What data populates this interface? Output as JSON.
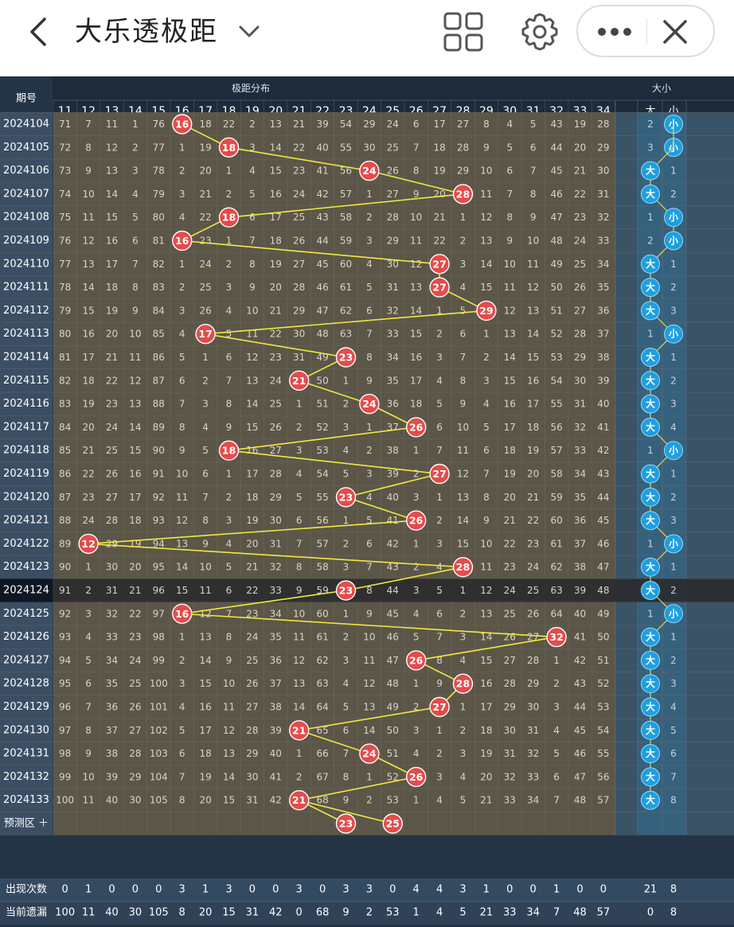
{
  "header": {
    "title": "大乐透极距",
    "icons": [
      "back-icon",
      "chevron-down-icon",
      "grid-icon",
      "gear-icon",
      "more-icon",
      "close-icon"
    ]
  },
  "chart": {
    "col_issue": "期号",
    "group_label": "极距分布",
    "size_label": "大小",
    "big": "大",
    "small": "小",
    "predict_label": "预测区 ＋",
    "stat_labels": [
      "出现次数",
      "当前遗漏"
    ]
  },
  "chart_data": {
    "type": "table",
    "columns": [
      11,
      12,
      13,
      14,
      15,
      16,
      17,
      18,
      19,
      20,
      21,
      22,
      23,
      24,
      25,
      26,
      27,
      28,
      29,
      30,
      31,
      32,
      33,
      34
    ],
    "rows": [
      {
        "issue": "2024104",
        "values": [
          71,
          7,
          11,
          1,
          76,
          16,
          18,
          22,
          2,
          13,
          21,
          39,
          54,
          29,
          24,
          6,
          17,
          27,
          8,
          4,
          5,
          43,
          19,
          28
        ],
        "size": [
          "2",
          "小"
        ]
      },
      {
        "issue": "2024105",
        "values": [
          72,
          8,
          12,
          2,
          77,
          1,
          19,
          18,
          3,
          14,
          22,
          40,
          55,
          30,
          25,
          7,
          18,
          28,
          9,
          5,
          6,
          44,
          20,
          29
        ],
        "size": [
          "3",
          "小"
        ]
      },
      {
        "issue": "2024106",
        "values": [
          73,
          9,
          13,
          3,
          78,
          2,
          20,
          1,
          4,
          15,
          23,
          41,
          56,
          24,
          26,
          8,
          19,
          29,
          10,
          6,
          7,
          45,
          21,
          30
        ],
        "size": [
          "大",
          "1"
        ]
      },
      {
        "issue": "2024107",
        "values": [
          74,
          10,
          14,
          4,
          79,
          3,
          21,
          2,
          5,
          16,
          24,
          42,
          57,
          1,
          27,
          9,
          20,
          28,
          11,
          7,
          8,
          46,
          22,
          31
        ],
        "size": [
          "大",
          "2"
        ]
      },
      {
        "issue": "2024108",
        "values": [
          75,
          11,
          15,
          5,
          80,
          4,
          22,
          18,
          6,
          17,
          25,
          43,
          58,
          2,
          28,
          10,
          21,
          1,
          12,
          8,
          9,
          47,
          23,
          32
        ],
        "size": [
          "1",
          "小"
        ]
      },
      {
        "issue": "2024109",
        "values": [
          76,
          12,
          16,
          6,
          81,
          16,
          23,
          1,
          7,
          18,
          26,
          44,
          59,
          3,
          29,
          11,
          22,
          2,
          13,
          9,
          10,
          48,
          24,
          33
        ],
        "size": [
          "2",
          "小"
        ]
      },
      {
        "issue": "2024110",
        "values": [
          77,
          13,
          17,
          7,
          82,
          1,
          24,
          2,
          8,
          19,
          27,
          45,
          60,
          4,
          30,
          12,
          27,
          3,
          14,
          10,
          11,
          49,
          25,
          34
        ],
        "size": [
          "大",
          "1"
        ]
      },
      {
        "issue": "2024111",
        "values": [
          78,
          14,
          18,
          8,
          83,
          2,
          25,
          3,
          9,
          20,
          28,
          46,
          61,
          5,
          31,
          13,
          27,
          4,
          15,
          11,
          12,
          50,
          26,
          35
        ],
        "size": [
          "大",
          "2"
        ]
      },
      {
        "issue": "2024112",
        "values": [
          79,
          15,
          19,
          9,
          84,
          3,
          26,
          4,
          10,
          21,
          29,
          47,
          62,
          6,
          32,
          14,
          1,
          5,
          29,
          12,
          13,
          51,
          27,
          36
        ],
        "size": [
          "大",
          "3"
        ]
      },
      {
        "issue": "2024113",
        "values": [
          80,
          16,
          20,
          10,
          85,
          4,
          17,
          5,
          11,
          22,
          30,
          48,
          63,
          7,
          33,
          15,
          2,
          6,
          1,
          13,
          14,
          52,
          28,
          37
        ],
        "size": [
          "1",
          "小"
        ]
      },
      {
        "issue": "2024114",
        "values": [
          81,
          17,
          21,
          11,
          86,
          5,
          1,
          6,
          12,
          23,
          31,
          49,
          23,
          8,
          34,
          16,
          3,
          7,
          2,
          14,
          15,
          53,
          29,
          38
        ],
        "size": [
          "大",
          "1"
        ]
      },
      {
        "issue": "2024115",
        "values": [
          82,
          18,
          22,
          12,
          87,
          6,
          2,
          7,
          13,
          24,
          21,
          50,
          1,
          9,
          35,
          17,
          4,
          8,
          3,
          15,
          16,
          54,
          30,
          39
        ],
        "size": [
          "大",
          "2"
        ]
      },
      {
        "issue": "2024116",
        "values": [
          83,
          19,
          23,
          13,
          88,
          7,
          3,
          8,
          14,
          25,
          1,
          51,
          2,
          24,
          36,
          18,
          5,
          9,
          4,
          16,
          17,
          55,
          31,
          40
        ],
        "size": [
          "大",
          "3"
        ]
      },
      {
        "issue": "2024117",
        "values": [
          84,
          20,
          24,
          14,
          89,
          8,
          4,
          9,
          15,
          26,
          2,
          52,
          3,
          1,
          37,
          26,
          6,
          10,
          5,
          17,
          18,
          56,
          32,
          41
        ],
        "size": [
          "大",
          "4"
        ]
      },
      {
        "issue": "2024118",
        "values": [
          85,
          21,
          25,
          15,
          90,
          9,
          5,
          18,
          16,
          27,
          3,
          53,
          4,
          2,
          38,
          1,
          7,
          11,
          6,
          18,
          19,
          57,
          33,
          42
        ],
        "size": [
          "1",
          "小"
        ]
      },
      {
        "issue": "2024119",
        "values": [
          86,
          22,
          26,
          16,
          91,
          10,
          6,
          1,
          17,
          28,
          4,
          54,
          5,
          3,
          39,
          2,
          27,
          12,
          7,
          19,
          20,
          58,
          34,
          43
        ],
        "size": [
          "大",
          "1"
        ]
      },
      {
        "issue": "2024120",
        "values": [
          87,
          23,
          27,
          17,
          92,
          11,
          7,
          2,
          18,
          29,
          5,
          55,
          23,
          4,
          40,
          3,
          1,
          13,
          8,
          20,
          21,
          59,
          35,
          44
        ],
        "size": [
          "大",
          "2"
        ]
      },
      {
        "issue": "2024121",
        "values": [
          88,
          24,
          28,
          18,
          93,
          12,
          8,
          3,
          19,
          30,
          6,
          56,
          1,
          5,
          41,
          26,
          2,
          14,
          9,
          21,
          22,
          60,
          36,
          45
        ],
        "size": [
          "大",
          "3"
        ]
      },
      {
        "issue": "2024122",
        "values": [
          89,
          12,
          29,
          19,
          94,
          13,
          9,
          4,
          20,
          31,
          7,
          57,
          2,
          6,
          42,
          1,
          3,
          15,
          10,
          22,
          23,
          61,
          37,
          46
        ],
        "size": [
          "1",
          "小"
        ]
      },
      {
        "issue": "2024123",
        "values": [
          90,
          1,
          30,
          20,
          95,
          14,
          10,
          5,
          21,
          32,
          8,
          58,
          3,
          7,
          43,
          2,
          4,
          28,
          11,
          23,
          24,
          62,
          38,
          47
        ],
        "size": [
          "大",
          "1"
        ]
      },
      {
        "issue": "2024124",
        "values": [
          91,
          2,
          31,
          21,
          96,
          15,
          11,
          6,
          22,
          33,
          9,
          59,
          23,
          8,
          44,
          3,
          5,
          1,
          12,
          24,
          25,
          63,
          39,
          48
        ],
        "size": [
          "大",
          "2"
        ]
      },
      {
        "issue": "2024125",
        "values": [
          92,
          3,
          32,
          22,
          97,
          16,
          12,
          7,
          23,
          34,
          10,
          60,
          1,
          9,
          45,
          4,
          6,
          2,
          13,
          25,
          26,
          64,
          40,
          49
        ],
        "size": [
          "1",
          "小"
        ]
      },
      {
        "issue": "2024126",
        "values": [
          93,
          4,
          33,
          23,
          98,
          1,
          13,
          8,
          24,
          35,
          11,
          61,
          2,
          10,
          46,
          5,
          7,
          3,
          14,
          26,
          27,
          32,
          41,
          50
        ],
        "size": [
          "大",
          "1"
        ]
      },
      {
        "issue": "2024127",
        "values": [
          94,
          5,
          34,
          24,
          99,
          2,
          14,
          9,
          25,
          36,
          12,
          62,
          3,
          11,
          47,
          26,
          8,
          4,
          15,
          27,
          28,
          1,
          42,
          51
        ],
        "size": [
          "大",
          "2"
        ]
      },
      {
        "issue": "2024128",
        "values": [
          95,
          6,
          35,
          25,
          100,
          3,
          15,
          10,
          26,
          37,
          13,
          63,
          4,
          12,
          48,
          1,
          9,
          28,
          16,
          28,
          29,
          2,
          43,
          52
        ],
        "size": [
          "大",
          "3"
        ]
      },
      {
        "issue": "2024129",
        "values": [
          96,
          7,
          36,
          26,
          101,
          4,
          16,
          11,
          27,
          38,
          14,
          64,
          5,
          13,
          49,
          2,
          27,
          1,
          17,
          29,
          30,
          3,
          44,
          53
        ],
        "size": [
          "大",
          "4"
        ]
      },
      {
        "issue": "2024130",
        "values": [
          97,
          8,
          37,
          27,
          102,
          5,
          17,
          12,
          28,
          39,
          21,
          65,
          6,
          14,
          50,
          3,
          1,
          2,
          18,
          30,
          31,
          4,
          45,
          54
        ],
        "size": [
          "大",
          "5"
        ]
      },
      {
        "issue": "2024131",
        "values": [
          98,
          9,
          38,
          28,
          103,
          6,
          18,
          13,
          29,
          40,
          1,
          66,
          7,
          24,
          51,
          4,
          2,
          3,
          19,
          31,
          32,
          5,
          46,
          55
        ],
        "size": [
          "大",
          "6"
        ]
      },
      {
        "issue": "2024132",
        "values": [
          99,
          10,
          39,
          29,
          104,
          7,
          19,
          14,
          30,
          41,
          2,
          67,
          8,
          1,
          52,
          26,
          3,
          4,
          20,
          32,
          33,
          6,
          47,
          56
        ],
        "size": [
          "大",
          "7"
        ]
      },
      {
        "issue": "2024133",
        "values": [
          100,
          11,
          40,
          30,
          105,
          8,
          20,
          15,
          31,
          42,
          21,
          68,
          9,
          2,
          53,
          1,
          4,
          5,
          21,
          33,
          34,
          7,
          48,
          57
        ],
        "size": [
          "大",
          "8"
        ]
      }
    ],
    "hits": [
      16,
      18,
      24,
      28,
      18,
      16,
      27,
      27,
      29,
      17,
      23,
      21,
      24,
      26,
      18,
      27,
      23,
      26,
      12,
      28,
      23,
      16,
      32,
      26,
      28,
      27,
      21,
      24,
      26,
      21
    ],
    "highlight_issue": "2024124",
    "prediction": [
      21,
      23,
      25
    ],
    "stats": {
      "appear": [
        0,
        1,
        0,
        0,
        0,
        3,
        1,
        3,
        0,
        0,
        3,
        0,
        3,
        3,
        0,
        4,
        4,
        3,
        1,
        0,
        0,
        1,
        0,
        0
      ],
      "miss": [
        100,
        11,
        40,
        30,
        105,
        8,
        20,
        15,
        31,
        42,
        0,
        68,
        9,
        2,
        53,
        1,
        4,
        5,
        21,
        33,
        34,
        7,
        48,
        57
      ],
      "size_appear": [
        "21",
        "8"
      ],
      "size_miss": [
        "0",
        "8"
      ]
    }
  }
}
